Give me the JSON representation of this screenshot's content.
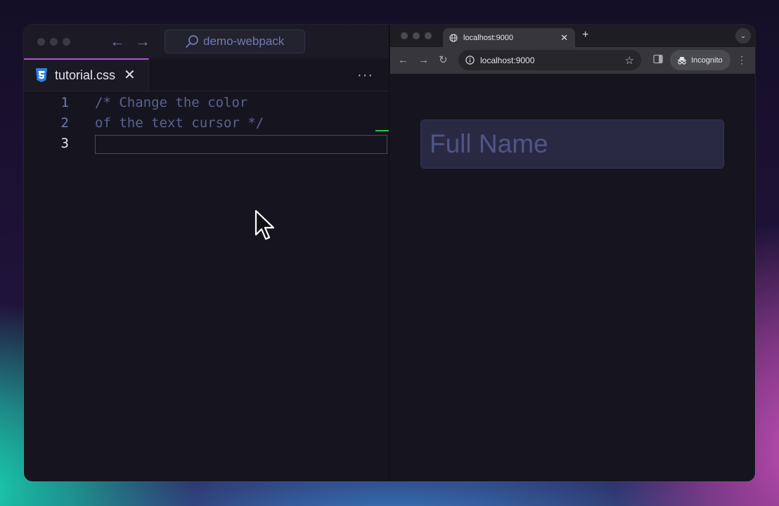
{
  "editor": {
    "search_text": "demo-webpack",
    "tab": {
      "label": "tutorial.css",
      "close": "✕"
    },
    "more": "···",
    "nav": {
      "back": "←",
      "forward": "→"
    },
    "lines": [
      {
        "number": "1",
        "text": "/* Change the color"
      },
      {
        "number": "2",
        "text": "of the text cursor */"
      },
      {
        "number": "3",
        "text": ""
      }
    ],
    "active_line": 3,
    "accent_color": "#b94fd8"
  },
  "browser": {
    "tab": {
      "title": "localhost:9000",
      "close": "✕"
    },
    "new_tab": "+",
    "tab_menu": "⌄",
    "toolbar": {
      "back": "←",
      "forward": "→",
      "reload": "↻",
      "menu": "⋮"
    },
    "address": "localhost:9000",
    "bookmark": "☆",
    "incognito_label": "Incognito",
    "page": {
      "input_placeholder": "Full Name"
    }
  },
  "icons": [
    "search-icon",
    "css3-icon",
    "close-icon",
    "globe-icon",
    "info-icon",
    "star-icon",
    "side-panel-icon",
    "incognito-icon",
    "mouse-pointer-icon"
  ]
}
